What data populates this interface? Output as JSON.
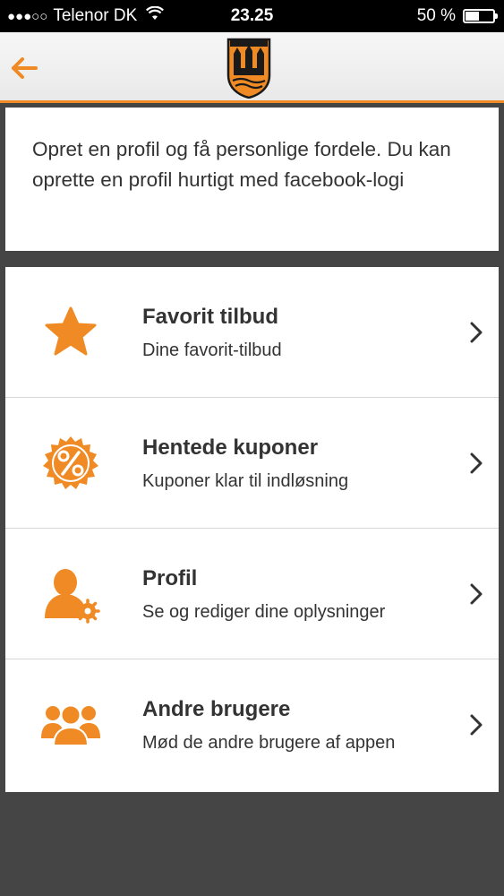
{
  "status_bar": {
    "carrier": "Telenor DK",
    "signal_dots": "●●●○○",
    "time": "23.25",
    "battery_text": "50 %",
    "battery_level": 0.5
  },
  "colors": {
    "accent": "#f08a24",
    "background": "#454545",
    "card": "#ffffff",
    "text": "#333333"
  },
  "nav": {
    "back_icon": "back-arrow-icon",
    "logo_icon": "club-crest-icon"
  },
  "intro": {
    "text": "Opret en profil og få personlige fordele. Du kan oprette en profil hurtigt med facebook-logi"
  },
  "menu": {
    "items": [
      {
        "title": "Favorit tilbud",
        "subtitle": "Dine favorit-tilbud",
        "icon": "star-icon"
      },
      {
        "title": "Hentede kuponer",
        "subtitle": "Kuponer klar til indløsning",
        "icon": "percent-badge-icon"
      },
      {
        "title": "Profil",
        "subtitle": "Se og rediger dine oplysninger",
        "icon": "user-settings-icon"
      },
      {
        "title": "Andre brugere",
        "subtitle": "Mød de andre brugere af appen",
        "icon": "users-group-icon"
      }
    ]
  }
}
